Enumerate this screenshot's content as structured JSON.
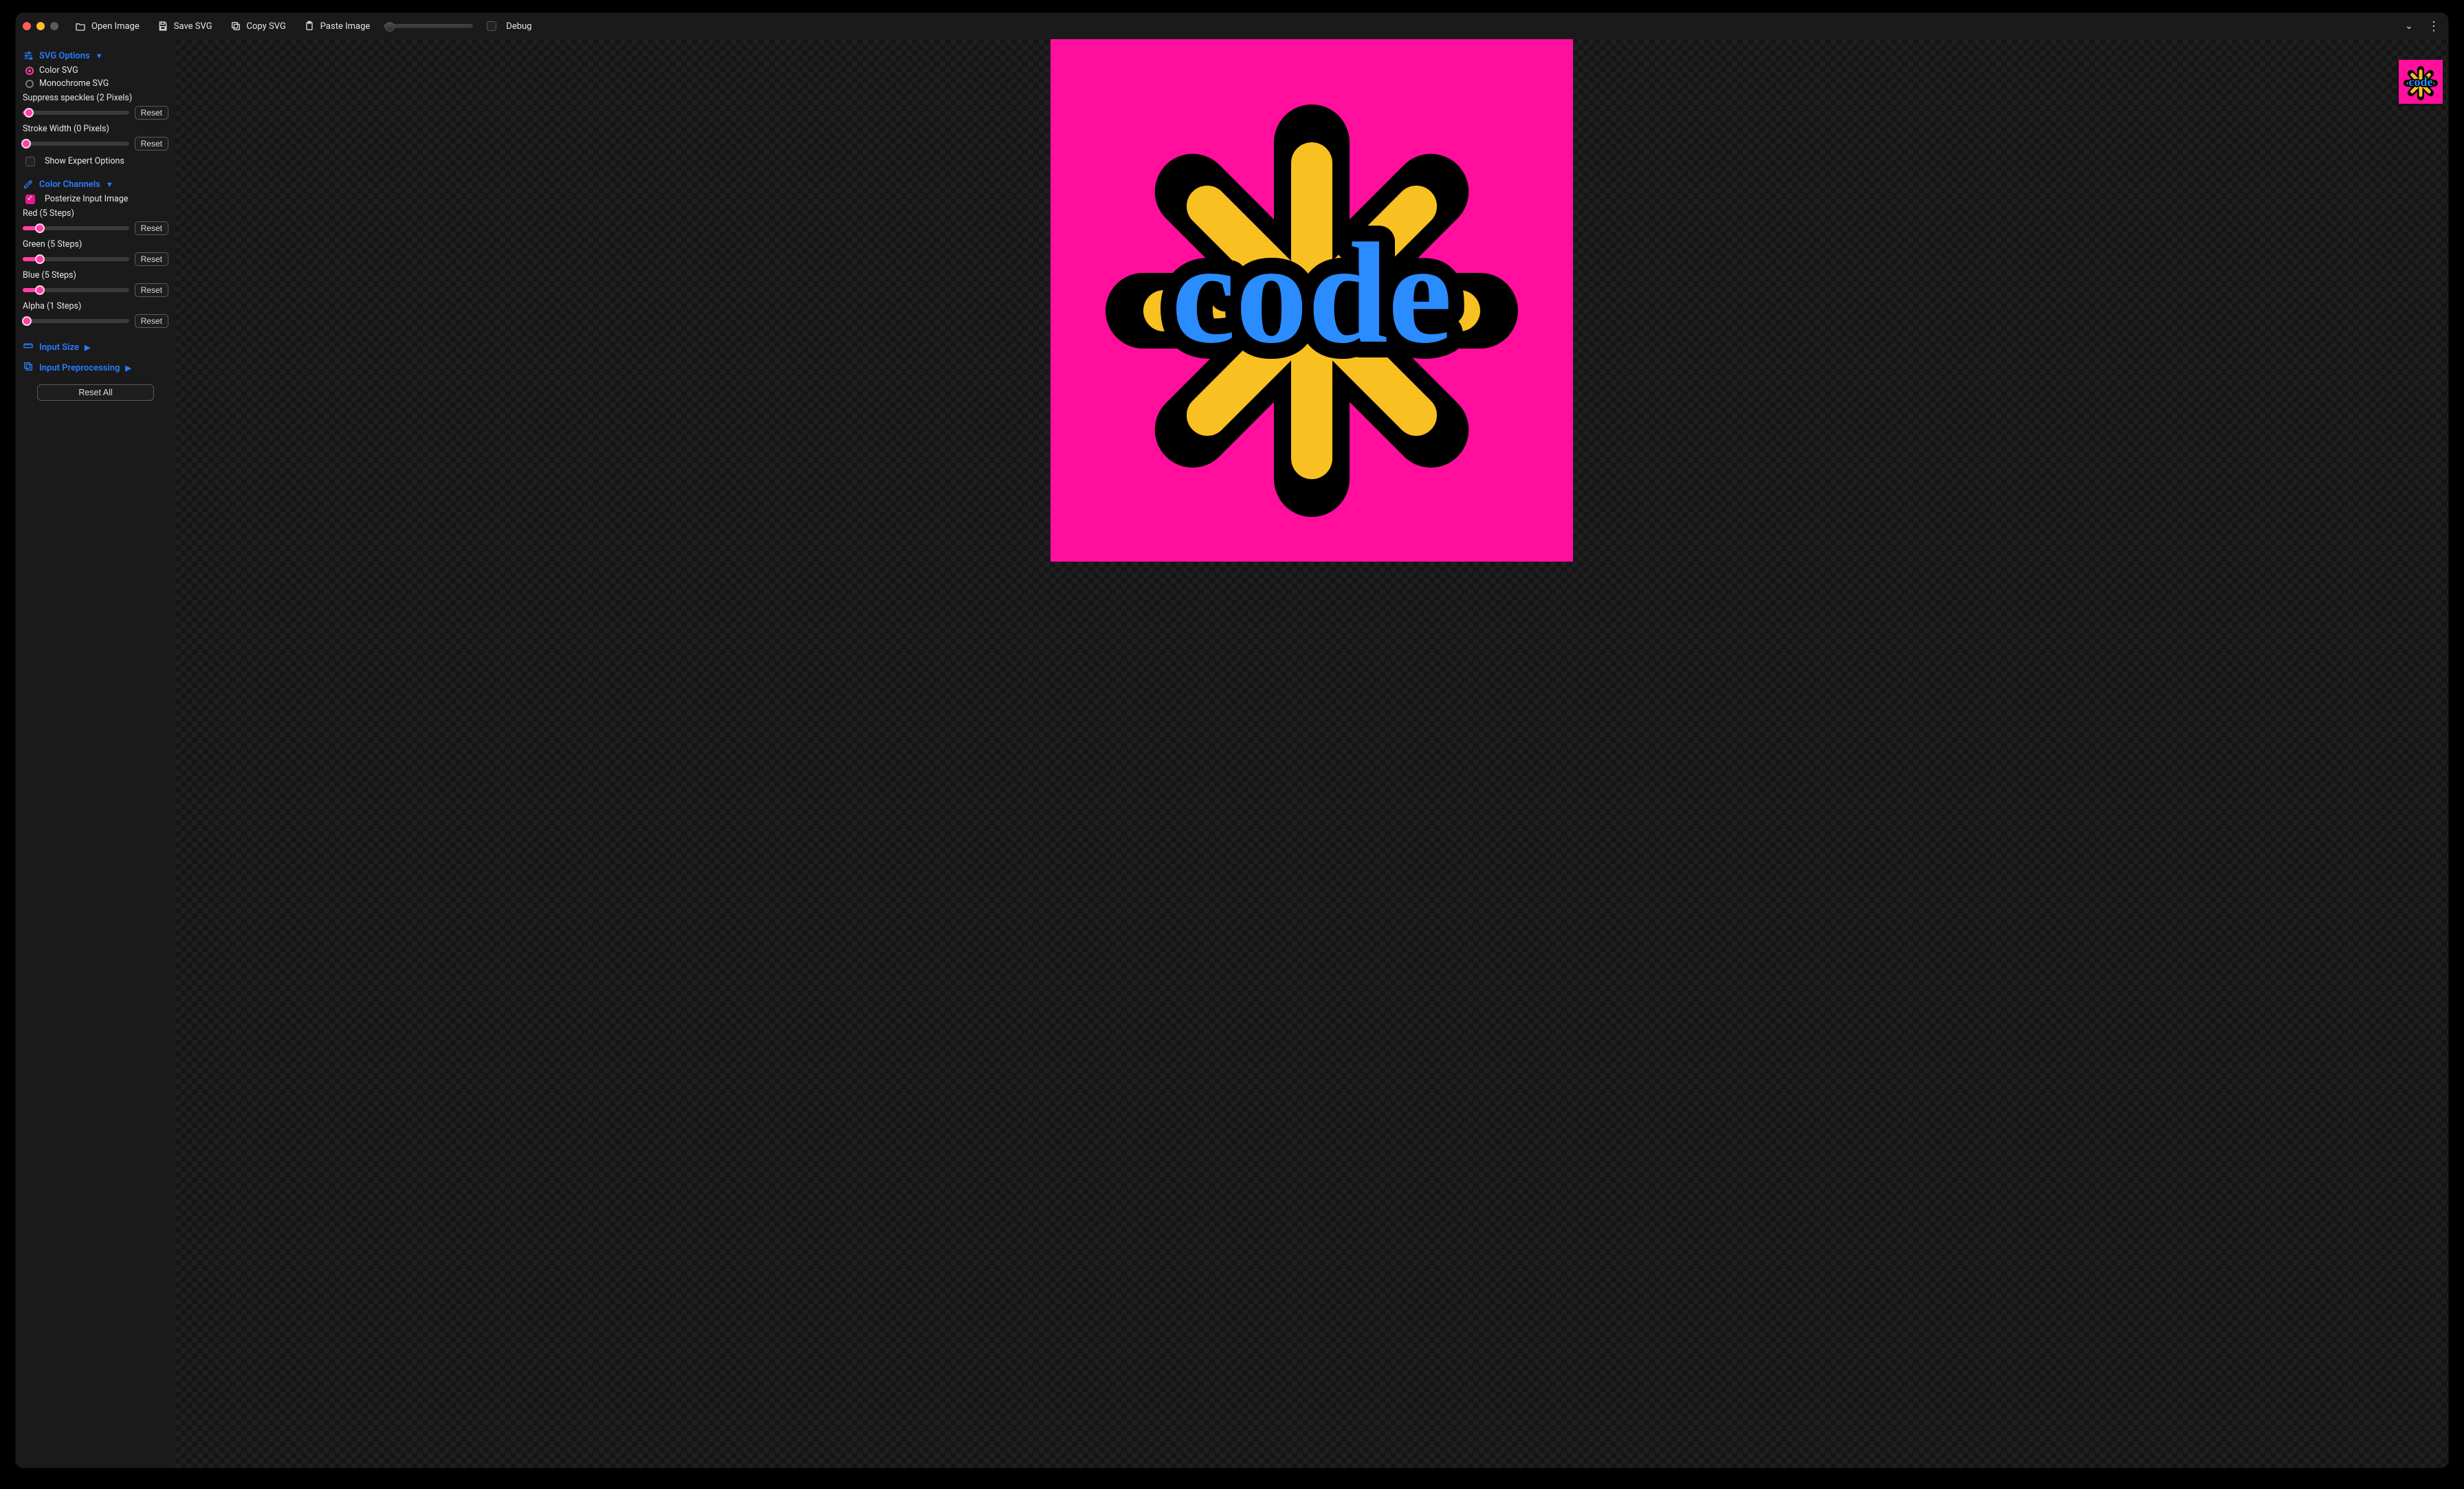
{
  "toolbar": {
    "open_label": "Open Image",
    "save_label": "Save SVG",
    "copy_label": "Copy SVG",
    "paste_label": "Paste Image",
    "debug_label": "Debug",
    "debug_checked": false
  },
  "sidebar": {
    "reset_label": "Reset",
    "reset_all_label": "Reset All",
    "svg_options": {
      "title": "SVG Options",
      "mode_color": "Color SVG",
      "mode_mono": "Monochrome SVG",
      "mode_selected": "color",
      "suppress": {
        "label": "Suppress speckles (2 Pixels)",
        "value": 2,
        "max": 100
      },
      "stroke": {
        "label": "Stroke Width (0 Pixels)",
        "value": 0,
        "max": 50
      },
      "expert": {
        "label": "Show Expert Options",
        "checked": false
      }
    },
    "color_channels": {
      "title": "Color Channels",
      "posterize": {
        "label": "Posterize Input Image",
        "checked": true
      },
      "red": {
        "label": "Red (5 Steps)",
        "value": 5,
        "max": 32
      },
      "green": {
        "label": "Green (5 Steps)",
        "value": 5,
        "max": 32
      },
      "blue": {
        "label": "Blue (5 Steps)",
        "value": 5,
        "max": 32
      },
      "alpha": {
        "label": "Alpha (1 Steps)",
        "value": 1,
        "max": 32
      }
    },
    "input_size": {
      "title": "Input Size"
    },
    "input_pre": {
      "title": "Input Preprocessing"
    }
  },
  "artwork": {
    "bg": "#ff0f9b",
    "outline": "#000000",
    "burst": "#f9c022",
    "text": "#2a8cff",
    "label": "code"
  }
}
